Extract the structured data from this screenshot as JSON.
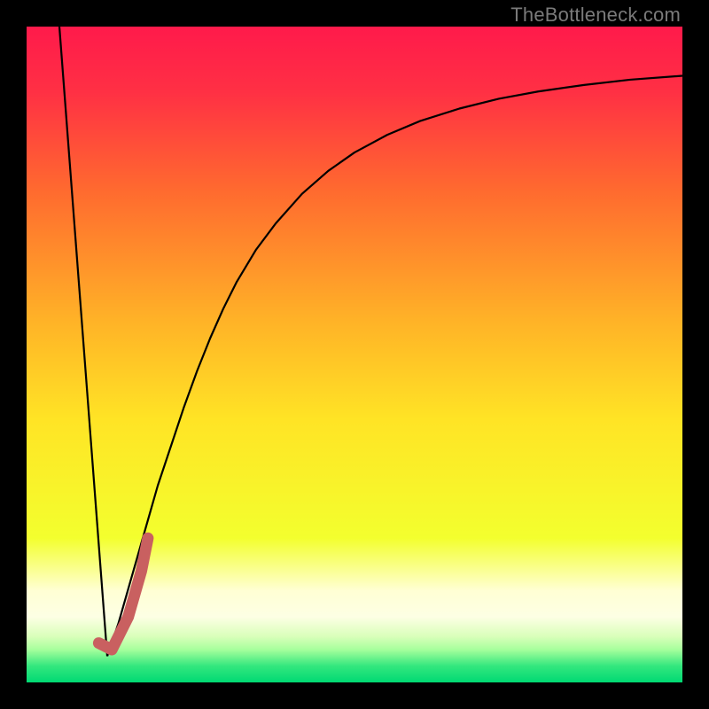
{
  "watermark": "TheBottleneck.com",
  "chart_data": {
    "type": "line",
    "title": "",
    "xlabel": "",
    "ylabel": "",
    "xlim": [
      0,
      100
    ],
    "ylim": [
      0,
      100
    ],
    "grid": false,
    "legend": "none",
    "background_gradient": {
      "stops": [
        {
          "pos": 0.0,
          "color": "#ff1a4b"
        },
        {
          "pos": 0.1,
          "color": "#ff3044"
        },
        {
          "pos": 0.25,
          "color": "#ff6a2f"
        },
        {
          "pos": 0.45,
          "color": "#ffb327"
        },
        {
          "pos": 0.6,
          "color": "#ffe425"
        },
        {
          "pos": 0.78,
          "color": "#f3ff2e"
        },
        {
          "pos": 0.86,
          "color": "#ffffd4"
        },
        {
          "pos": 0.9,
          "color": "#fdffe4"
        },
        {
          "pos": 0.93,
          "color": "#d9ffba"
        },
        {
          "pos": 0.95,
          "color": "#a6ff9c"
        },
        {
          "pos": 0.975,
          "color": "#33e77e"
        },
        {
          "pos": 1.0,
          "color": "#00d973"
        }
      ]
    },
    "series": [
      {
        "name": "left-line",
        "color": "#000000",
        "width": 2.2,
        "x": [
          5.0,
          12.3
        ],
        "y": [
          100.0,
          4.0
        ]
      },
      {
        "name": "main-curve",
        "color": "#000000",
        "width": 2.2,
        "x": [
          12.3,
          14,
          16,
          18,
          20,
          22,
          24,
          26,
          28,
          30,
          32,
          35,
          38,
          42,
          46,
          50,
          55,
          60,
          66,
          72,
          78,
          85,
          92,
          100
        ],
        "y": [
          4.0,
          9,
          16,
          23,
          30,
          36,
          42,
          47.5,
          52.5,
          57,
          61,
          66,
          70,
          74.5,
          78,
          80.8,
          83.5,
          85.6,
          87.5,
          89,
          90.1,
          91.1,
          91.9,
          92.5
        ]
      },
      {
        "name": "highlight-segment",
        "color": "#c96060",
        "width": 13,
        "linecap": "round",
        "x": [
          11.0,
          13.0,
          15.5,
          17.5,
          18.5
        ],
        "y": [
          6.0,
          5.0,
          10.0,
          17.0,
          22.0
        ]
      }
    ]
  }
}
